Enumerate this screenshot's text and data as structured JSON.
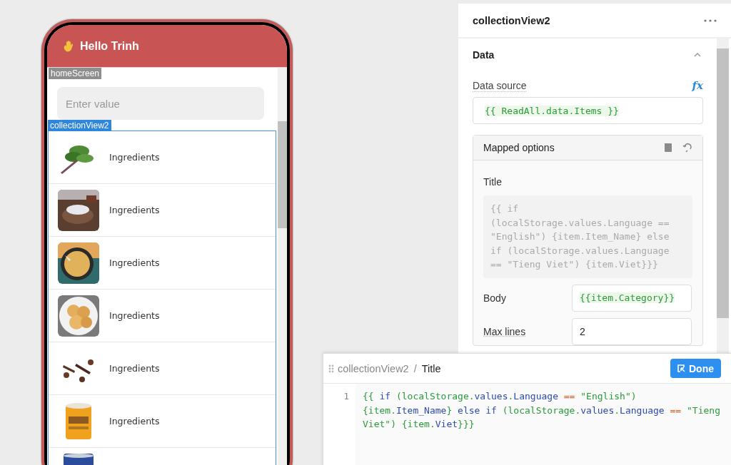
{
  "phone": {
    "header_title": "Hello Trinh",
    "screen_tag": "homeScreen",
    "search": {
      "placeholder": "Enter value"
    },
    "list_tag": "collectionView2",
    "items": [
      {
        "kind": "picture",
        "title": "Ingredients"
      },
      {
        "kind": "picture",
        "title": "Ingredients"
      },
      {
        "kind": "picture",
        "title": "Ingredients"
      },
      {
        "kind": "picture",
        "title": "Ingredients"
      },
      {
        "kind": "picture",
        "title": "Ingredients"
      },
      {
        "kind": "picture",
        "title": "Ingredients"
      },
      {
        "kind": "picture"
      }
    ]
  },
  "inspector": {
    "title": "collectionView2",
    "section": {
      "title": "Data",
      "expanded": true
    },
    "data_source": {
      "label": "Data source",
      "fx": "fx",
      "value": "{{ ReadAll.data.Items }}"
    },
    "mapped_options": {
      "title": "Mapped options",
      "title_field": {
        "label": "Title",
        "value": "{{ if (localStorage.values.Language == \"English\") {item.Item_Name} else if (localStorage.values.Language == \"Tieng Viet\") {item.Viet}}}"
      },
      "body_field": {
        "label": "Body",
        "value": "{{item.Category}}"
      },
      "max_lines": {
        "label": "Max lines",
        "value": "2"
      }
    }
  },
  "editor": {
    "breadcrumb": [
      "collectionView2",
      "Title"
    ],
    "separator": "/",
    "done": "Done",
    "line_number": "1",
    "tokens": [
      {
        "text": "{{ ",
        "kind": "string"
      },
      {
        "text": "if",
        "kind": "keyword"
      },
      {
        "text": " (localStorage.",
        "kind": "string"
      },
      {
        "text": "values",
        "kind": "keyword"
      },
      {
        "text": ".",
        "kind": "string"
      },
      {
        "text": "Language",
        "kind": "keyword"
      },
      {
        "text": " ==",
        "kind": "operator"
      },
      {
        "text": " \"English\") {item.",
        "kind": "string"
      },
      {
        "text": "Item_Name",
        "kind": "keyword"
      },
      {
        "text": "} ",
        "kind": "string"
      },
      {
        "text": "else if",
        "kind": "keyword"
      },
      {
        "text": " (localStorage.",
        "kind": "string"
      },
      {
        "text": "values",
        "kind": "keyword"
      },
      {
        "text": ".",
        "kind": "string"
      },
      {
        "text": "Language",
        "kind": "keyword"
      },
      {
        "text": " ==",
        "kind": "operator"
      },
      {
        "text": " \"Tieng Viet\") {item.",
        "kind": "string"
      },
      {
        "text": "Viet",
        "kind": "keyword"
      },
      {
        "text": "}}}",
        "kind": "string"
      }
    ]
  }
}
